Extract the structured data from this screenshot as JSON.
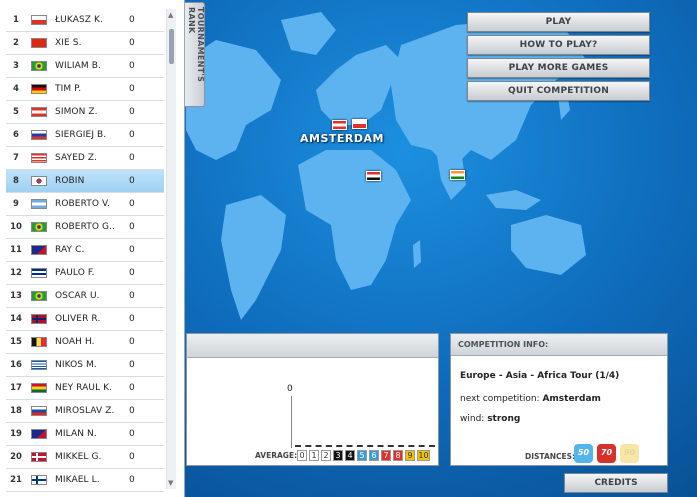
{
  "ranking": {
    "tab_label": "TOURNAMENT'S RANK",
    "players": [
      {
        "pos": "1",
        "name": "ŁUKASZ K.",
        "score": "0",
        "flag": "poland"
      },
      {
        "pos": "2",
        "name": "XIE S.",
        "score": "0",
        "flag": "china"
      },
      {
        "pos": "3",
        "name": "WILIAM B.",
        "score": "0",
        "flag": "brazil"
      },
      {
        "pos": "4",
        "name": "TIM P.",
        "score": "0",
        "flag": "germany"
      },
      {
        "pos": "5",
        "name": "SIMON Z.",
        "score": "0",
        "flag": "austria"
      },
      {
        "pos": "6",
        "name": "SIERGIEJ B.",
        "score": "0",
        "flag": "russia"
      },
      {
        "pos": "7",
        "name": "SAYED Z.",
        "score": "0",
        "flag": "malaysia"
      },
      {
        "pos": "8",
        "name": "ROBIN",
        "score": "0",
        "flag": "korea",
        "selected": true
      },
      {
        "pos": "9",
        "name": "ROBERTO V.",
        "score": "0",
        "flag": "argentina"
      },
      {
        "pos": "10",
        "name": "ROBERTO G..",
        "score": "0",
        "flag": "brazil"
      },
      {
        "pos": "11",
        "name": "RAY C.",
        "score": "0",
        "flag": "australia"
      },
      {
        "pos": "12",
        "name": "PAULO F.",
        "score": "0",
        "flag": "cuba"
      },
      {
        "pos": "13",
        "name": "OSCAR U.",
        "score": "0",
        "flag": "brazil"
      },
      {
        "pos": "14",
        "name": "OLIVER R.",
        "score": "0",
        "flag": "norway"
      },
      {
        "pos": "15",
        "name": "NOAH H.",
        "score": "0",
        "flag": "belgium"
      },
      {
        "pos": "16",
        "name": "NIKOS M.",
        "score": "0",
        "flag": "greece"
      },
      {
        "pos": "17",
        "name": "NEY RAUL K.",
        "score": "0",
        "flag": "ghana"
      },
      {
        "pos": "18",
        "name": "MIROSLAV Z.",
        "score": "0",
        "flag": "slovakia"
      },
      {
        "pos": "19",
        "name": "MILAN N.",
        "score": "0",
        "flag": "australia"
      },
      {
        "pos": "20",
        "name": "MIKKEL G.",
        "score": "0",
        "flag": "denmark"
      },
      {
        "pos": "21",
        "name": "MIKAEL L.",
        "score": "0",
        "flag": "finland"
      }
    ]
  },
  "map": {
    "current_city": "AMSTERDAM"
  },
  "menu": {
    "play": "PLAY",
    "how_to_play": "HOW TO PLAY?",
    "more_games": "PLAY MORE GAMES",
    "quit": "QUIT COMPETITION"
  },
  "results": {
    "zero_value": "0",
    "average_label": "AVERAGE:",
    "average_boxes": [
      {
        "v": "0",
        "bg": "#ffffff",
        "fg": "#333333"
      },
      {
        "v": "1",
        "bg": "#ffffff",
        "fg": "#333333"
      },
      {
        "v": "2",
        "bg": "#ffffff",
        "fg": "#333333"
      },
      {
        "v": "3",
        "bg": "#111111",
        "fg": "#ffffff"
      },
      {
        "v": "4",
        "bg": "#111111",
        "fg": "#ffffff"
      },
      {
        "v": "5",
        "bg": "#3a9bdc",
        "fg": "#ffffff"
      },
      {
        "v": "6",
        "bg": "#3a9bdc",
        "fg": "#ffffff"
      },
      {
        "v": "7",
        "bg": "#e0322b",
        "fg": "#ffffff"
      },
      {
        "v": "8",
        "bg": "#e0322b",
        "fg": "#ffffff"
      },
      {
        "v": "9",
        "bg": "#f2c400",
        "fg": "#333333"
      },
      {
        "v": "10",
        "bg": "#f2c400",
        "fg": "#333333"
      }
    ]
  },
  "competition": {
    "header": "COMPETITION INFO:",
    "tour": "Europe - Asia - Africa Tour (1/4)",
    "next_label": "next competition:",
    "next_value": "Amsterdam",
    "wind_label": "wind:",
    "wind_value": "strong",
    "distances_label": "DISTANCES:",
    "distances": [
      {
        "v": "50",
        "color": "#55b4ea"
      },
      {
        "v": "70",
        "color": "#d8312b"
      },
      {
        "v": "90",
        "color": "#f7e6a8"
      }
    ]
  },
  "credits": "CREDITS"
}
